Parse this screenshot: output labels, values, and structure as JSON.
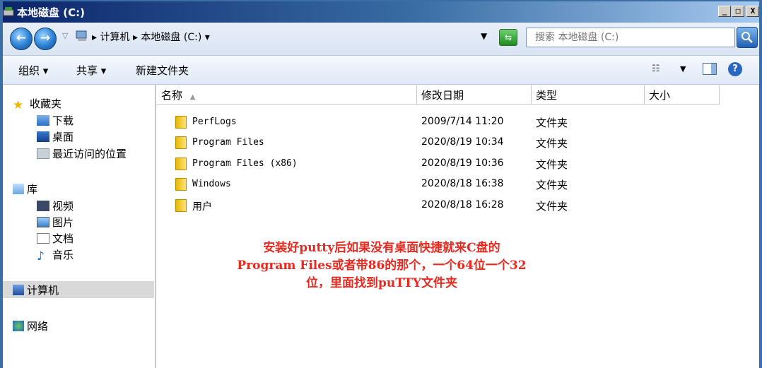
{
  "window": {
    "title": "本地磁盘 (C:)",
    "minimize_glyph": "_",
    "maximize_glyph": "□",
    "close_glyph": "X"
  },
  "address": {
    "crumbs": [
      "计算机",
      "本地磁盘 (C:)"
    ],
    "search_placeholder": "搜索 本地磁盘 (C:)"
  },
  "toolbar": {
    "organize": "组织 ▾",
    "share": "共享 ▾",
    "new_folder": "新建文件夹"
  },
  "nav": {
    "favorites_label": "收藏夹",
    "favorites": [
      "下载",
      "桌面",
      "最近访问的位置"
    ],
    "library_label": "库",
    "library": [
      "视频",
      "图片",
      "文档",
      "音乐"
    ],
    "computer_label": "计算机",
    "network_label": "网络"
  },
  "columns": {
    "name": "名称",
    "date": "修改日期",
    "type": "类型",
    "size": "大小"
  },
  "files": [
    {
      "name": "PerfLogs",
      "date": "2009/7/14 11:20",
      "type": "文件夹"
    },
    {
      "name": "Program Files",
      "date": "2020/8/19 10:34",
      "type": "文件夹"
    },
    {
      "name": "Program Files (x86)",
      "date": "2020/8/19 10:36",
      "type": "文件夹"
    },
    {
      "name": "Windows",
      "date": "2020/8/18 16:38",
      "type": "文件夹"
    },
    {
      "name": "用户",
      "date": "2020/8/18 16:28",
      "type": "文件夹"
    }
  ],
  "annotation": {
    "line1": "安装好putty后如果没有桌面快捷就来C盘的",
    "line2": "Program Files或者带86的那个，一个64位一个32",
    "line3": "位，里面找到puTTY文件夹"
  },
  "colors": {
    "title_bar": "#0a246a",
    "annotation": "#e8291f",
    "selection": "#d9d9d9"
  }
}
